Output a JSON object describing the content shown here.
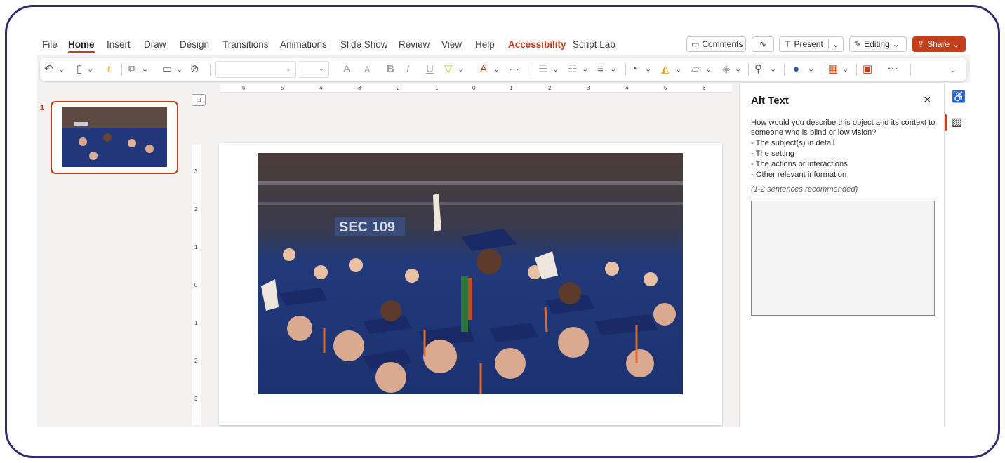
{
  "menubar": {
    "tabs": [
      "File",
      "Home",
      "Insert",
      "Draw",
      "Design",
      "Transitions",
      "Animations",
      "Slide Show",
      "Review",
      "View",
      "Help",
      "Accessibility",
      "Script Lab"
    ],
    "comments": "Comments",
    "present": "Present",
    "editing": "Editing",
    "share": "Share"
  },
  "toolbar": {
    "icons": [
      "undo-icon",
      "clipboard-icon",
      "format-painter-icon",
      "new-slide-icon",
      "layout-icon",
      "hide-icon",
      "font-size-increase-icon",
      "font-size-decrease-icon",
      "bold-icon",
      "italic-icon",
      "underline-icon",
      "highlight-icon",
      "font-color-icon",
      "more-icon",
      "bullets-icon",
      "numbering-icon",
      "align-icon",
      "shapes-icon",
      "shape-fill-icon",
      "shape-outline-icon",
      "arrange-icon",
      "find-icon",
      "dictate-icon",
      "designer-icon",
      "add-in-icon",
      "overflow-icon"
    ],
    "glyphs": {
      "undo": "↶",
      "bold": "B",
      "italic": "I",
      "underline": "U",
      "grow": "A",
      "shrink": "A",
      "more": "···",
      "find": "⚲",
      "chevron": "⌄"
    }
  },
  "thumbnails": [
    {
      "number": "1"
    }
  ],
  "ruler": {
    "h_labels": [
      "6",
      "5",
      "4",
      "3",
      "2",
      "1",
      "0",
      "1",
      "2",
      "3",
      "4",
      "5",
      "6"
    ],
    "v_labels": [
      "3",
      "2",
      "1",
      "0",
      "1",
      "2",
      "3"
    ]
  },
  "alt_text": {
    "title": "Alt Text",
    "close": "×",
    "lines": [
      "How would you describe this object and its context to",
      "someone who is blind or low vision?",
      "- The subject(s) in detail",
      "- The setting",
      "- The actions or interactions",
      "- Other relevant information"
    ],
    "hint": "(1-2 sentences recommended)",
    "value": ""
  },
  "photo": {
    "sign": "SEC 109"
  },
  "colors": {
    "accent": "#c43e1c",
    "frame": "#2f2a6e"
  }
}
